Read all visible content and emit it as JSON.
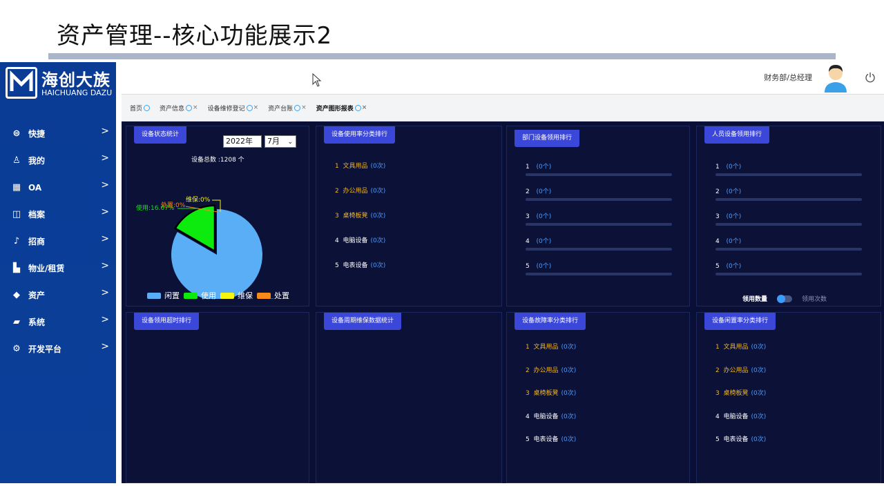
{
  "slide": {
    "title": "资产管理--核心功能展示2"
  },
  "logo": {
    "cn": "海创大族",
    "en": "HAICHUANG DAZU"
  },
  "sidebar": {
    "items": [
      {
        "label": "快捷",
        "icon": "menu-circle-icon"
      },
      {
        "label": "我的",
        "icon": "user-icon"
      },
      {
        "label": "OA",
        "icon": "calendar-icon"
      },
      {
        "label": "档案",
        "icon": "archive-icon"
      },
      {
        "label": "招商",
        "icon": "bell-icon"
      },
      {
        "label": "物业/租赁",
        "icon": "building-icon"
      },
      {
        "label": "资产",
        "icon": "diamond-icon"
      },
      {
        "label": "系统",
        "icon": "folder-icon"
      },
      {
        "label": "开发平台",
        "icon": "gear-icon"
      }
    ],
    "chevron": ">"
  },
  "header": {
    "user": "财务部/总经理"
  },
  "tabs": [
    {
      "label": "首页",
      "closable": false
    },
    {
      "label": "资产信息",
      "closable": true
    },
    {
      "label": "设备维修登记",
      "closable": true
    },
    {
      "label": "资产台账",
      "closable": true
    },
    {
      "label": "资产图形报表",
      "closable": true,
      "active": true
    }
  ],
  "tab_close": "×",
  "panels": {
    "status": {
      "title": "设备状态统计",
      "year": "2022年",
      "month": "7月",
      "total": "设备总数 :1208   个",
      "slice_labels": {
        "idle": "闲置:83.33%",
        "use": "使用:16.67%",
        "maint": "维保:0%",
        "dispose": "处置:0%"
      },
      "legend": [
        {
          "name": "闲置",
          "color": "#5aaef6"
        },
        {
          "name": "使用",
          "color": "#0dea0d"
        },
        {
          "name": "维保",
          "color": "#f5f510"
        },
        {
          "name": "处置",
          "color": "#f78a1a"
        }
      ]
    },
    "usage_rate": {
      "title": "设备使用率分类排行",
      "rows": [
        {
          "rank": "1",
          "name": "文具用品",
          "count": "(0次)"
        },
        {
          "rank": "2",
          "name": "办公用品",
          "count": "(0次)"
        },
        {
          "rank": "3",
          "name": "桌椅板凳",
          "count": "(0次)"
        },
        {
          "rank": "4",
          "name": "电脑设备",
          "count": "(0次)"
        },
        {
          "rank": "5",
          "name": "电表设备",
          "count": "(0次)"
        }
      ]
    },
    "dept": {
      "title": "部门设备领用排行",
      "rows": [
        {
          "rank": "1",
          "count": "(0个)",
          "fill": 0
        },
        {
          "rank": "2",
          "count": "(0个)",
          "fill": 0
        },
        {
          "rank": "3",
          "count": "(0个)",
          "fill": 0
        },
        {
          "rank": "4",
          "count": "(0个)",
          "fill": 0
        },
        {
          "rank": "5",
          "count": "(0个)",
          "fill": 0
        }
      ]
    },
    "person": {
      "title": "人员设备领用排行",
      "rows": [
        {
          "rank": "1",
          "count": "(0个)",
          "fill": 0
        },
        {
          "rank": "2",
          "count": "(0个)",
          "fill": 0
        },
        {
          "rank": "3",
          "count": "(0个)",
          "fill": 0
        },
        {
          "rank": "4",
          "count": "(0个)",
          "fill": 0
        },
        {
          "rank": "5",
          "count": "(0个)",
          "fill": 0
        }
      ],
      "toggle_left": "领用数量",
      "toggle_right": "领用次数"
    },
    "overdue": {
      "title": "设备领用超时排行"
    },
    "maint_cycle": {
      "title": "设备周期维保数据统计"
    },
    "failure_rate": {
      "title": "设备故障率分类排行",
      "rows": [
        {
          "rank": "1",
          "name": "文具用品",
          "count": "(0次)"
        },
        {
          "rank": "2",
          "name": "办公用品",
          "count": "(0次)"
        },
        {
          "rank": "3",
          "name": "桌椅板凳",
          "count": "(0次)"
        },
        {
          "rank": "4",
          "name": "电脑设备",
          "count": "(0次)"
        },
        {
          "rank": "5",
          "name": "电表设备",
          "count": "(0次)"
        }
      ]
    },
    "idle_rate": {
      "title": "设备闲置率分类排行",
      "rows": [
        {
          "rank": "1",
          "name": "文具用品",
          "count": "(0次)"
        },
        {
          "rank": "2",
          "name": "办公用品",
          "count": "(0次)"
        },
        {
          "rank": "3",
          "name": "桌椅板凳",
          "count": "(0次)"
        },
        {
          "rank": "4",
          "name": "电脑设备",
          "count": "(0次)"
        },
        {
          "rank": "5",
          "name": "电表设备",
          "count": "(0次)"
        }
      ]
    }
  },
  "chart_data": {
    "type": "pie",
    "categories": [
      "闲置",
      "使用",
      "维保",
      "处置"
    ],
    "values": [
      83.33,
      16.67,
      0,
      0
    ],
    "colors": [
      "#5aaef6",
      "#0dea0d",
      "#f5f510",
      "#f78a1a"
    ],
    "legend": "bottom"
  }
}
